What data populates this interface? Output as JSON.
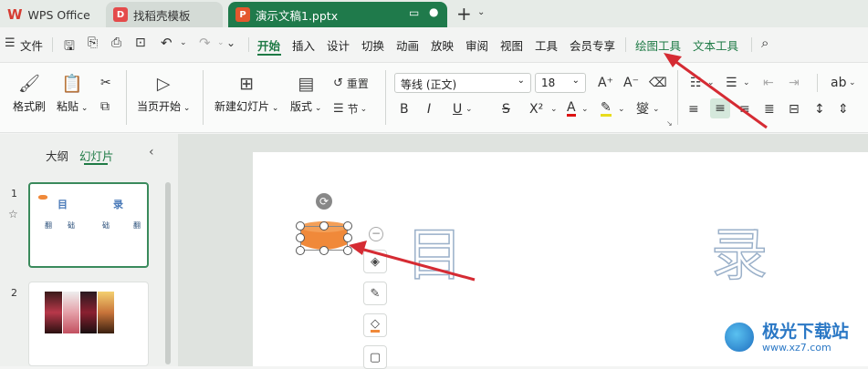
{
  "tabs": [
    {
      "label": "WPS Office"
    },
    {
      "label": "找稻壳模板"
    },
    {
      "label": "演示文稿1.pptx"
    }
  ],
  "menu": {
    "file": "文件",
    "items": [
      "开始",
      "插入",
      "设计",
      "切换",
      "动画",
      "放映",
      "审阅",
      "视图",
      "工具",
      "会员专享"
    ],
    "drawing_tools": "绘图工具",
    "text_tools": "文本工具"
  },
  "ribbon": {
    "format_painter": "格式刷",
    "paste": "粘贴",
    "from_current": "当页开始",
    "new_slide": "新建幻灯片",
    "layout": "版式",
    "reset": "重置",
    "section": "节",
    "font_name": "等线 (正文)",
    "font_size": "18",
    "bold": "B",
    "italic": "I",
    "underline": "U",
    "strike": "S",
    "superscript": "X²",
    "font_color_letter": "A",
    "char_spacing": "燮"
  },
  "panel": {
    "outline_tab": "大纲",
    "slides_tab": "幻灯片",
    "slide1_number": "1",
    "slide2_number": "2",
    "thumb1_title_left": "目",
    "thumb1_title_right": "录",
    "thumb1_items": [
      "翻",
      "础",
      "础",
      "翻"
    ]
  },
  "slide": {
    "title_left": "目",
    "title_right": "录"
  },
  "watermark": {
    "name": "极光下载站",
    "url": "www.xz7.com"
  },
  "colors": {
    "accent_green": "#1e7a45",
    "shape_orange": "#f0893a",
    "arrow_red": "#d52b33",
    "pptx_tab": "#1f7a4b"
  }
}
